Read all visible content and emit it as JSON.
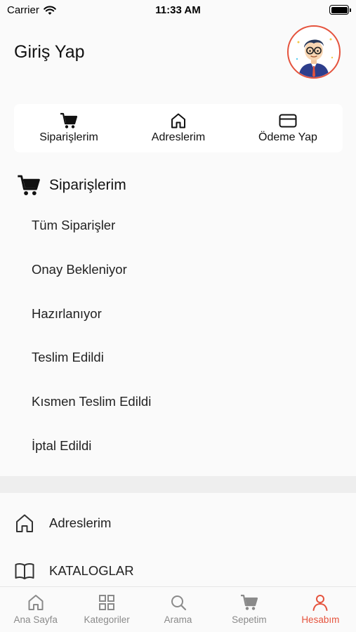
{
  "status_bar": {
    "carrier": "Carrier",
    "time": "11:33 AM"
  },
  "header": {
    "title": "Giriş Yap"
  },
  "quick_actions": [
    {
      "label": "Siparişlerim",
      "icon": "cart-icon"
    },
    {
      "label": "Adreslerim",
      "icon": "home-icon"
    },
    {
      "label": "Ödeme Yap",
      "icon": "credit-card-icon"
    }
  ],
  "orders": {
    "title": "Siparişlerim",
    "items": [
      "Tüm Siparişler",
      "Onay Bekleniyor",
      "Hazırlanıyor",
      "Teslim Edildi",
      "Kısmen Teslim Edildi",
      "İptal Edildi"
    ]
  },
  "menu": [
    {
      "label": "Adreslerim",
      "icon": "home-icon"
    },
    {
      "label": "KATALOGLAR",
      "icon": "book-icon"
    }
  ],
  "tab_bar": {
    "items": [
      {
        "label": "Ana Sayfa",
        "icon": "home-icon"
      },
      {
        "label": "Kategoriler",
        "icon": "grid-icon"
      },
      {
        "label": "Arama",
        "icon": "search-icon"
      },
      {
        "label": "Sepetim",
        "icon": "cart-icon"
      },
      {
        "label": "Hesabım",
        "icon": "user-icon"
      }
    ],
    "active_index": 4
  },
  "colors": {
    "accent": "#e5533d",
    "inactive": "#8a8a8a",
    "background": "#fafafa"
  }
}
